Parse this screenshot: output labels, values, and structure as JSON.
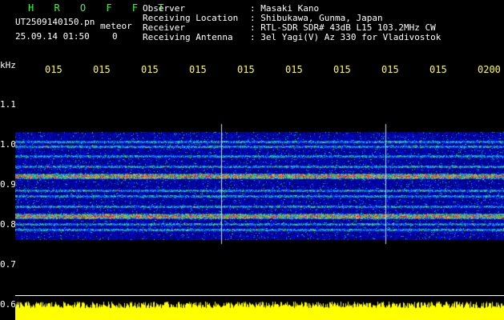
{
  "header": {
    "station": "H R O F F T",
    "filename": "UT2509140150.pn",
    "datetime": "25.09.14 01:50",
    "type": "meteor",
    "count": "0"
  },
  "info": [
    {
      "key": "Observer",
      "value": ": Masaki Kano"
    },
    {
      "key": "Receiving Location",
      "value": ": Shibukawa, Gunma, Japan"
    },
    {
      "key": "Receiver",
      "value": ": RTL-SDR SDR# 43dB L15 103.2MHz CW"
    },
    {
      "key": "Receiving Antenna",
      "value": ": 3el Yagi(V) Az 330 for Vladivostok"
    }
  ],
  "axis": {
    "unit": "kHz",
    "y_ticks": [
      "1.1",
      "1.0",
      "0.9",
      "0.8",
      "0.7",
      "0.6"
    ],
    "x_ticks": [
      "015",
      "015",
      "015",
      "015",
      "015",
      "015",
      "015",
      "015",
      "015",
      "0200"
    ]
  },
  "colors": {
    "text": "#ffffff",
    "title": "#33ff33",
    "ticks": "#ffff33",
    "background": "#000000",
    "noise_floor": "#ffff00",
    "signal": "#ff3333"
  }
}
